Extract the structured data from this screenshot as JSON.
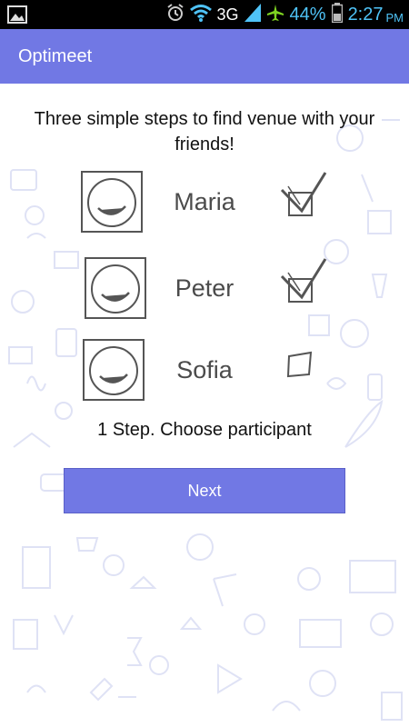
{
  "status_bar": {
    "network": "3G",
    "battery": "44%",
    "time": "2:27",
    "ampm": "PM"
  },
  "app": {
    "title": "Optimeet"
  },
  "intro_text": "Three simple steps to find venue with your friends!",
  "participants": [
    {
      "name": "Maria",
      "checked": true
    },
    {
      "name": "Peter",
      "checked": true
    },
    {
      "name": "Sofia",
      "checked": false
    }
  ],
  "step_label": "1 Step. Choose participant",
  "next_label": "Next",
  "colors": {
    "accent": "#7178e4",
    "doodle": "#dfe2f5"
  }
}
